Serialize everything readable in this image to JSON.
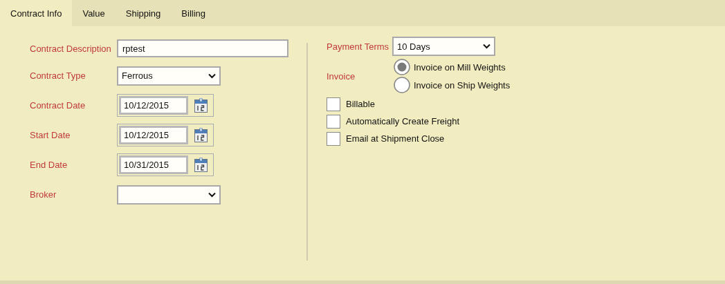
{
  "tabs": [
    {
      "label": "Contract Info",
      "selected": true
    },
    {
      "label": "Value",
      "selected": false
    },
    {
      "label": "Shipping",
      "selected": false
    },
    {
      "label": "Billing",
      "selected": false
    }
  ],
  "left_fields": [
    {
      "kind": "text",
      "label": "Contract Description",
      "value": "rptest"
    },
    {
      "kind": "select",
      "label": "Contract Type",
      "value": "Ferrous"
    },
    {
      "kind": "date",
      "label": "Contract Date",
      "value": "10/12/2015"
    },
    {
      "kind": "date",
      "label": "Start Date",
      "value": "10/12/2015"
    },
    {
      "kind": "date",
      "label": "End Date",
      "value": "10/31/2015"
    },
    {
      "kind": "select",
      "label": "Broker"
    }
  ],
  "payment_terms": {
    "label": "Payment Terms",
    "value": "10 Days"
  },
  "invoice": {
    "label": "Invoice",
    "options": [
      {
        "label": "Invoice on Mill Weights",
        "selected": true
      },
      {
        "label": "Invoice on Ship Weights",
        "selected": false
      }
    ]
  },
  "checkboxes": [
    {
      "label": "Billable",
      "checked": false
    },
    {
      "label": "Automatically Create Freight",
      "checked": false
    },
    {
      "label": "Email at Shipment Close",
      "checked": false
    }
  ]
}
